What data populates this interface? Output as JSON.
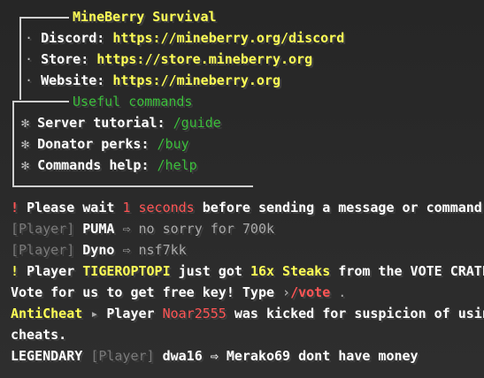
{
  "server_box": {
    "title": "MineBerry Survival",
    "links": [
      {
        "label": "Discord:",
        "url": "https://mineberry.org/discord"
      },
      {
        "label": "Store:",
        "url": "https://store.mineberry.org"
      },
      {
        "label": "Website:",
        "url": "https://mineberry.org"
      }
    ],
    "commands_title": "Useful commands",
    "commands": [
      {
        "label": "Server tutorial:",
        "cmd": "/guide"
      },
      {
        "label": "Donator perks:",
        "cmd": "/buy"
      },
      {
        "label": "Commands help:",
        "cmd": "/help"
      }
    ]
  },
  "messages": {
    "wait": {
      "bang": "!",
      "pre": "Please wait",
      "count": "1 seconds",
      "post": "before sending a message or command."
    },
    "puma": {
      "tag": "[Player]",
      "name": "PUMA",
      "arrow": "⇨",
      "text": "no sorry for 700k"
    },
    "dyno": {
      "tag": "[Player]",
      "name": "Dyno",
      "arrow": "⇨",
      "text": "nsf7kk"
    },
    "vote_crate": {
      "bang": "!",
      "pre": "Player",
      "name": "TIGEROPTOPI",
      "mid": "just got",
      "reward": "16x Steaks",
      "from": "from the VOTE CRATE",
      "bang2": "!"
    },
    "vote": {
      "pre": "Vote for us to get free key! Type",
      "arrow": "›",
      "cmd": "/vote",
      "post": "."
    },
    "anticheat": {
      "tag": "AntiCheat",
      "arrow": "▸",
      "pre": "Player",
      "name": "Noar2555",
      "post": "was kicked for suspicion of using",
      "cont": "cheats."
    },
    "legendary": {
      "rank": "LEGENDARY",
      "tag": "[Player]",
      "name": "dwa16",
      "arrow": "⇨",
      "text": "Merako69 dont have money"
    }
  },
  "colors": {
    "yellow": "#ffff55",
    "green": "#55ff55",
    "red": "#ff5555",
    "gray": "#aaaaaa"
  }
}
